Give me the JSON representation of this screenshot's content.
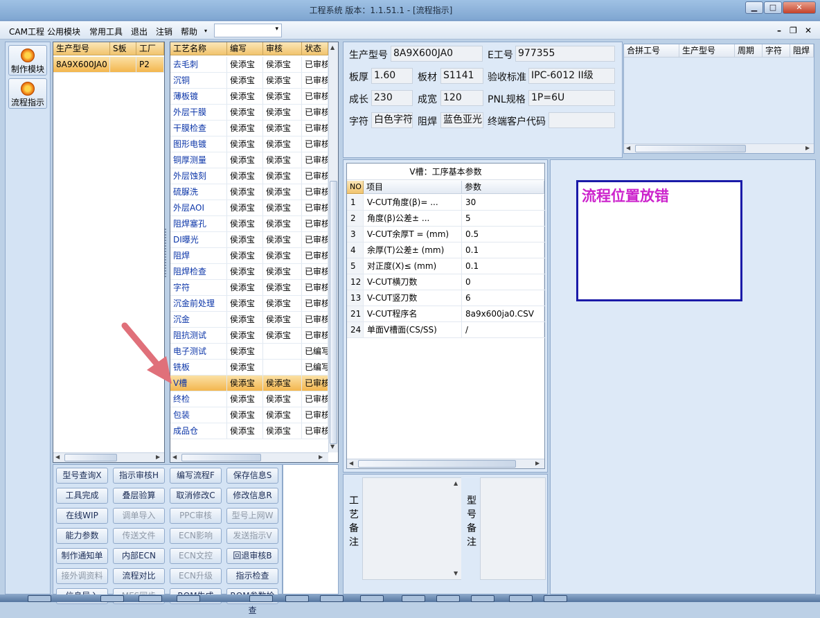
{
  "window": {
    "title": "工程系统   版本：1.1.51.1 - [流程指示]",
    "btn_min": "▁",
    "btn_max": "□",
    "btn_close": "✕"
  },
  "menu": {
    "items": [
      "CAM工程",
      "公用模块",
      "常用工具",
      "退出",
      "注销",
      "帮助"
    ],
    "dropdown_arrow": "▾",
    "mdi_min": "–",
    "mdi_restore": "❐",
    "mdi_close": "✕"
  },
  "sidebar": {
    "items": [
      {
        "label": "制作模块",
        "icon": "flame-icon"
      },
      {
        "label": "流程指示",
        "icon": "pause-icon"
      }
    ]
  },
  "products": {
    "headers": [
      "生产型号",
      "S板",
      "工厂"
    ],
    "rows": [
      {
        "model": "8A9X600JA0",
        "s": "",
        "factory": "P2"
      }
    ]
  },
  "process": {
    "headers": [
      "工艺名称",
      "编写",
      "审核",
      "状态"
    ],
    "selected_index": 20,
    "rows": [
      [
        "去毛刺",
        "侯添宝",
        "侯添宝",
        "已审核"
      ],
      [
        "沉铜",
        "侯添宝",
        "侯添宝",
        "已审核"
      ],
      [
        "薄板镀",
        "侯添宝",
        "侯添宝",
        "已审核"
      ],
      [
        "外层干膜",
        "侯添宝",
        "侯添宝",
        "已审核"
      ],
      [
        "干膜检查",
        "侯添宝",
        "侯添宝",
        "已审核"
      ],
      [
        "图形电镀",
        "侯添宝",
        "侯添宝",
        "已审核"
      ],
      [
        "铜厚测量",
        "侯添宝",
        "侯添宝",
        "已审核"
      ],
      [
        "外层蚀刻",
        "侯添宝",
        "侯添宝",
        "已审核"
      ],
      [
        "硫脲洗",
        "侯添宝",
        "侯添宝",
        "已审核"
      ],
      [
        "外层AOI",
        "侯添宝",
        "侯添宝",
        "已审核"
      ],
      [
        "阻焊塞孔",
        "侯添宝",
        "侯添宝",
        "已审核"
      ],
      [
        "DI曝光",
        "侯添宝",
        "侯添宝",
        "已审核"
      ],
      [
        "阻焊",
        "侯添宝",
        "侯添宝",
        "已审核"
      ],
      [
        "阻焊检查",
        "侯添宝",
        "侯添宝",
        "已审核"
      ],
      [
        "字符",
        "侯添宝",
        "侯添宝",
        "已审核"
      ],
      [
        "沉金前处理",
        "侯添宝",
        "侯添宝",
        "已审核"
      ],
      [
        "沉金",
        "侯添宝",
        "侯添宝",
        "已审核"
      ],
      [
        "阻抗测试",
        "侯添宝",
        "侯添宝",
        "已审核"
      ],
      [
        "电子测试",
        "侯添宝",
        "",
        "已编写"
      ],
      [
        "铣板",
        "侯添宝",
        "",
        "已编写"
      ],
      [
        "V槽",
        "侯添宝",
        "侯添宝",
        "已审核"
      ],
      [
        "终检",
        "侯添宝",
        "侯添宝",
        "已审核"
      ],
      [
        "包装",
        "侯添宝",
        "侯添宝",
        "已审核"
      ],
      [
        "成品仓",
        "侯添宝",
        "侯添宝",
        "已审核"
      ]
    ]
  },
  "buttons": [
    [
      {
        "label": "型号查询X",
        "enabled": true
      },
      {
        "label": "指示审核H",
        "enabled": true
      },
      {
        "label": "编写流程F",
        "enabled": true
      },
      {
        "label": "保存信息S",
        "enabled": true
      }
    ],
    [
      {
        "label": "工具完成",
        "enabled": true
      },
      {
        "label": "叠层验算",
        "enabled": true
      },
      {
        "label": "取消修改C",
        "enabled": true
      },
      {
        "label": "修改信息R",
        "enabled": true
      }
    ],
    [
      {
        "label": "在线WIP",
        "enabled": true
      },
      {
        "label": "调单导入",
        "enabled": false
      },
      {
        "label": "PPC审核",
        "enabled": false
      },
      {
        "label": "型号上网W",
        "enabled": false
      }
    ],
    [
      {
        "label": "能力参数",
        "enabled": true
      },
      {
        "label": "传送文件",
        "enabled": false
      },
      {
        "label": "ECN影响",
        "enabled": false
      },
      {
        "label": "发送指示V",
        "enabled": false
      }
    ],
    [
      {
        "label": "制作通知单",
        "enabled": true
      },
      {
        "label": "内部ECN",
        "enabled": true
      },
      {
        "label": "ECN文控",
        "enabled": false
      },
      {
        "label": "回退审核B",
        "enabled": true
      }
    ],
    [
      {
        "label": "接外调资料",
        "enabled": false
      },
      {
        "label": "流程对比",
        "enabled": true
      },
      {
        "label": "ECN升级",
        "enabled": false
      },
      {
        "label": "指示检查",
        "enabled": true
      }
    ],
    [
      {
        "label": "信息导入",
        "enabled": true
      },
      {
        "label": "MES同步",
        "enabled": false
      },
      {
        "label": "ROM生成",
        "enabled": true
      },
      {
        "label": "ROM参数检查",
        "enabled": true
      }
    ]
  ],
  "info": {
    "model_label": "生产型号",
    "model": "8A9X600JA0",
    "e_label": "E工号",
    "e_no": "977355",
    "thick_label": "板厚",
    "thick": "1.60",
    "mat_label": "板材",
    "mat": "S1141",
    "std_label": "验收标准",
    "std": "IPC-6012 II级",
    "len_label": "成长",
    "len": "230",
    "wid_label": "成宽",
    "wid": "120",
    "pnl_label": "PNL规格",
    "pnl": "1P=6U",
    "char_label": "字符",
    "char": "白色字符",
    "mask_label": "阻焊",
    "mask": "蓝色亚光",
    "cust_label": "终端客户代码",
    "cust": ""
  },
  "merge": {
    "headers": [
      "合拼工号",
      "生产型号",
      "周期",
      "字符",
      "阻焊"
    ]
  },
  "params": {
    "title": "V槽：工序基本参数",
    "headers": [
      "NO",
      "项目",
      "参数"
    ],
    "rows": [
      [
        "1",
        "V-CUT角度(β)=  ...",
        "30"
      ],
      [
        "2",
        "角度(β)公差±  ...",
        "5"
      ],
      [
        "3",
        "V-CUT余厚T =  (mm)",
        "0.5"
      ],
      [
        "4",
        "余厚(T)公差±  (mm)",
        "0.1"
      ],
      [
        "5",
        "对正度(X)≤ (mm)",
        "0.1"
      ],
      [
        "12",
        "V-CUT横刀数",
        "0"
      ],
      [
        "13",
        "V-CUT竖刀数",
        "6"
      ],
      [
        "21",
        "V-CUT程序名",
        "8a9x600ja0.CSV"
      ],
      [
        "24",
        "单面V槽面(CS/SS)",
        "/"
      ]
    ]
  },
  "notes": {
    "process_label": "工\n艺\n备\n注",
    "model_label": "型\n号\n备\n注",
    "process_value": "",
    "model_value": ""
  },
  "annotation": {
    "text": "流程位置放错",
    "color": "#cc22cc",
    "border": "#1a1aa8",
    "arrow_color": "#e0707a"
  }
}
